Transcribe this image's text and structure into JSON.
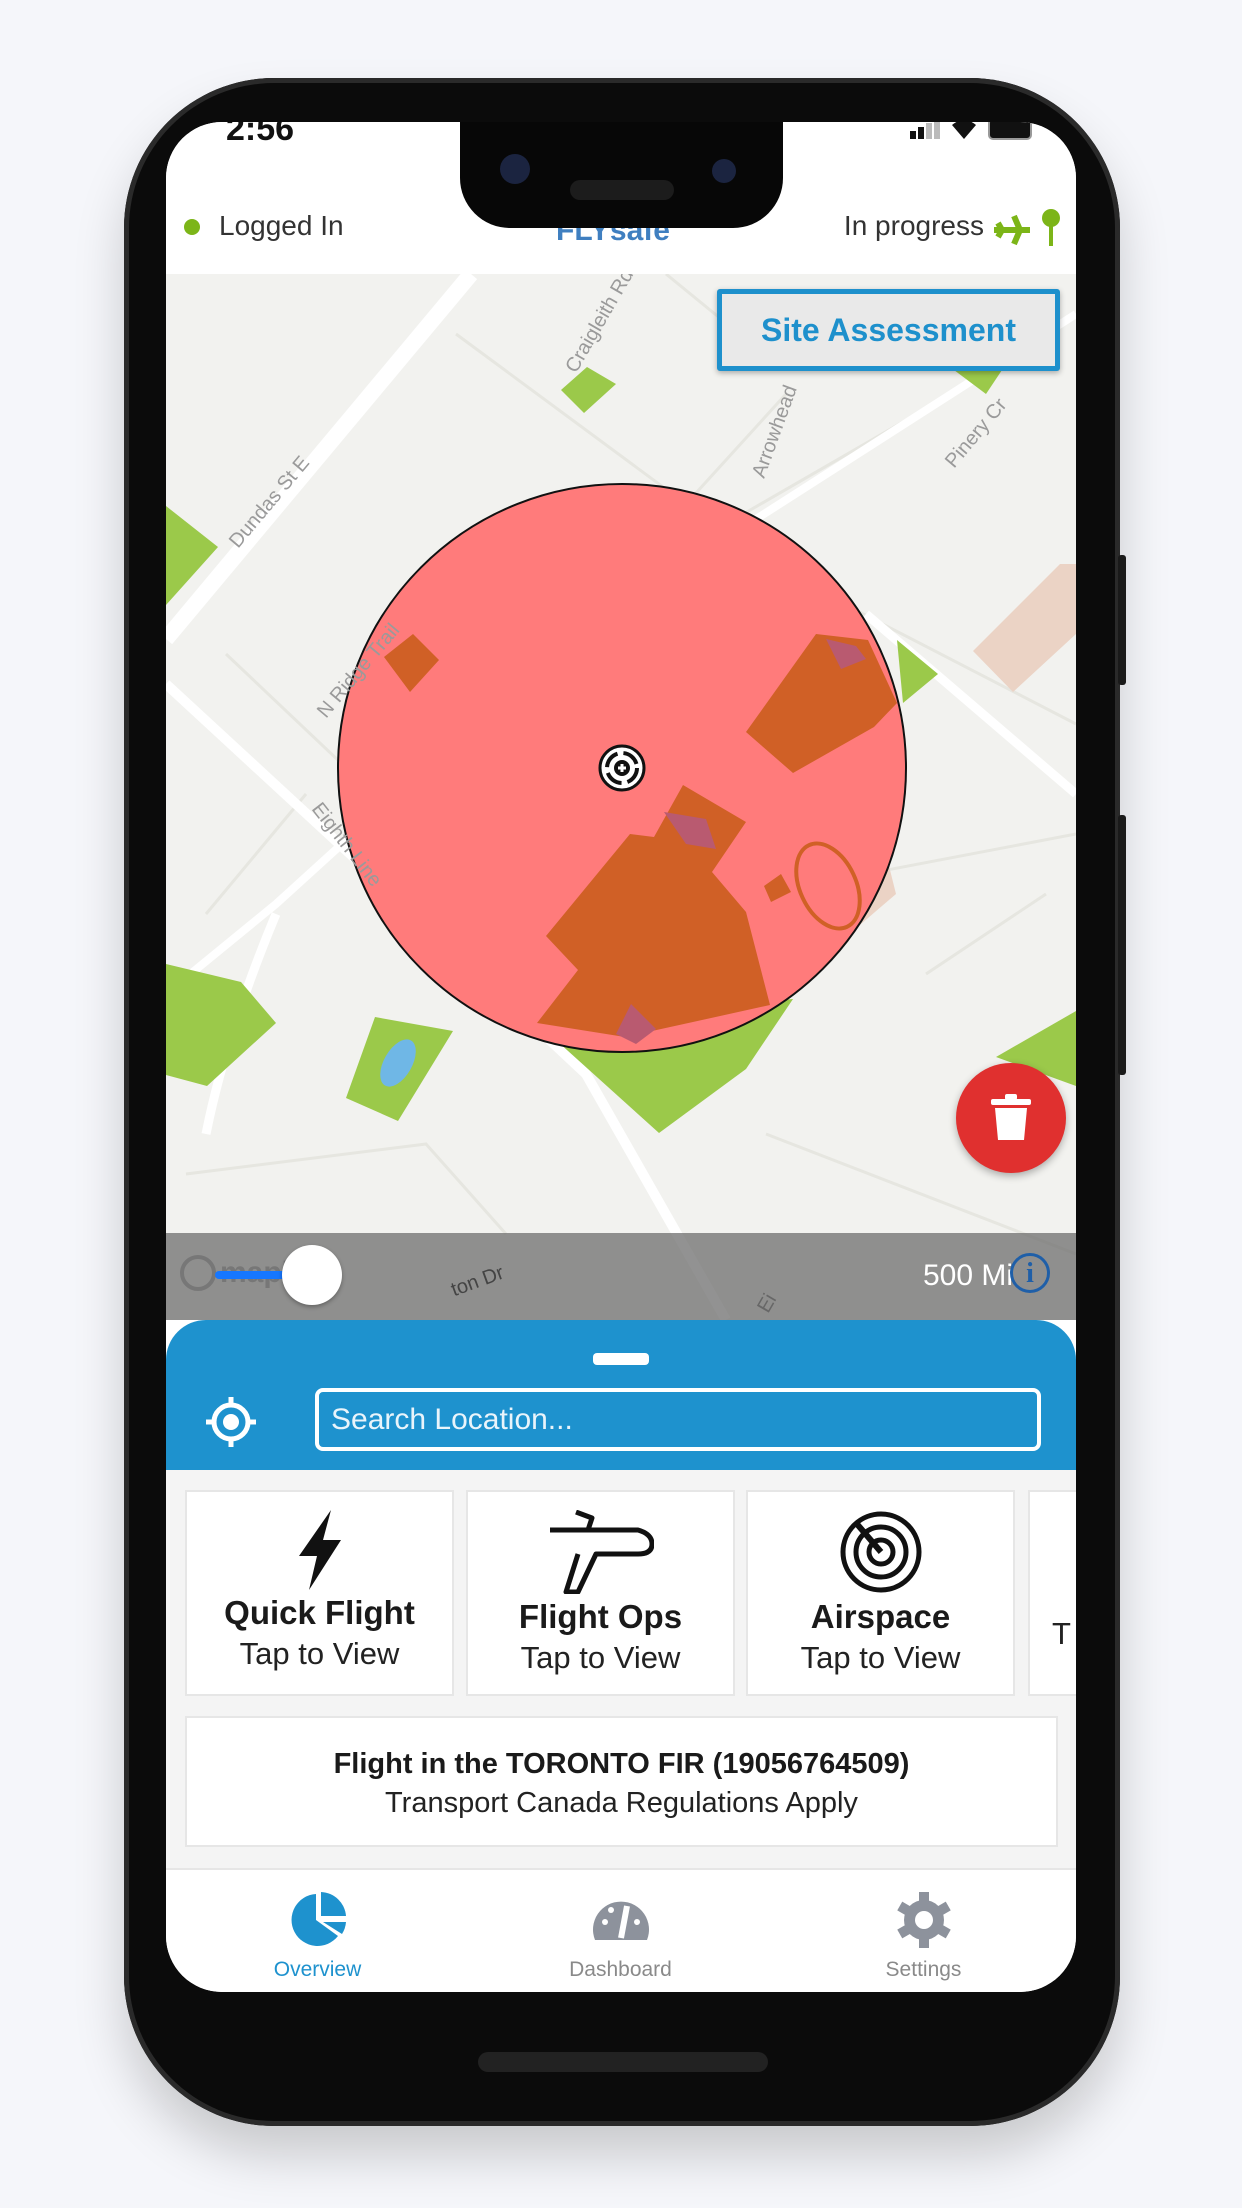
{
  "status_bar": {
    "time": "2:56"
  },
  "header": {
    "login_status": "Logged In",
    "logo": "FLYsafe",
    "flight_status": "In progress",
    "status_dot_color": "#7cb518",
    "status_icons": [
      "airplane-icon",
      "pin-icon"
    ]
  },
  "map": {
    "site_assessment_label": "Site Assessment",
    "street_labels": [
      "Dundas St E",
      "Craigleith Rd",
      "Arrowhead",
      "Pinery Cr",
      "N Ridge Trail",
      "Eighth Line",
      "ton Dr",
      "Ei"
    ],
    "scale_label": "500 Mi",
    "attribution": "mapbox",
    "radius_slider_fraction": 0.1,
    "zone_color": "#ff6b6b"
  },
  "search": {
    "placeholder": "Search Location..."
  },
  "cards": [
    {
      "title": "Quick Flight",
      "subtitle": "Tap to View",
      "icon": "lightning-icon"
    },
    {
      "title": "Flight Ops",
      "subtitle": "Tap to View",
      "icon": "airplane-icon"
    },
    {
      "title": "Airspace",
      "subtitle": "Tap to View",
      "icon": "radar-icon"
    },
    {
      "title": "",
      "subtitle": "T",
      "icon": ""
    }
  ],
  "info_card": {
    "title": "Flight in the TORONTO FIR (19056764509)",
    "subtitle": "Transport Canada  Regulations Apply"
  },
  "tabs": [
    {
      "label": "Overview",
      "icon": "pie-chart-icon",
      "active": true
    },
    {
      "label": "Dashboard",
      "icon": "gauge-icon",
      "active": false
    },
    {
      "label": "Settings",
      "icon": "gear-icon",
      "active": false
    }
  ],
  "colors": {
    "primary": "#1e92ce",
    "danger": "#e0302f",
    "tab_inactive": "#8a8a8a"
  }
}
